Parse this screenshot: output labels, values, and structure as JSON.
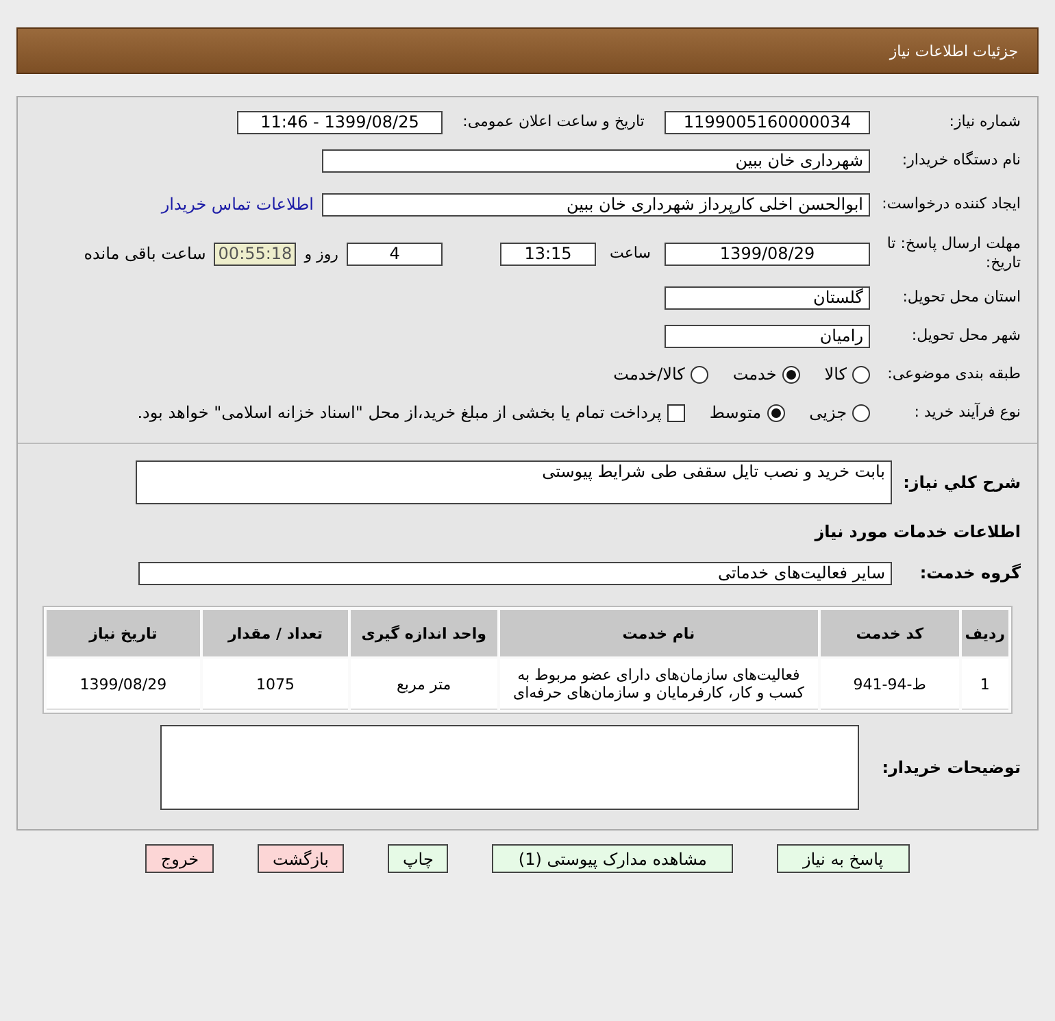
{
  "header": {
    "title": "جزئیات اطلاعات نیاز"
  },
  "need_number": {
    "label": "شماره نیاز:",
    "value": "1199005160000034"
  },
  "announce": {
    "label": "تاریخ و ساعت اعلان عمومی:",
    "value": "1399/08/25 - 11:46"
  },
  "buyer_org": {
    "label": "نام دستگاه خریدار:",
    "value": "شهرداری خان ببین"
  },
  "requester": {
    "label": "ایجاد کننده درخواست:",
    "value": "ابوالحسن اخلی کارپرداز شهرداری خان ببین",
    "link": "اطلاعات تماس خریدار"
  },
  "deadline": {
    "label": "مهلت ارسال پاسخ: تا تاریخ:",
    "date": "1399/08/29",
    "time_label": "ساعت",
    "time": "13:15",
    "days": "4",
    "days_label": "روز و",
    "remaining": "00:55:18",
    "remaining_label": "ساعت باقی مانده"
  },
  "province": {
    "label": "استان محل تحویل:",
    "value": "گلستان"
  },
  "city": {
    "label": "شهر محل تحویل:",
    "value": "رامیان"
  },
  "category": {
    "label": "طبقه بندی موضوعی:",
    "options": [
      {
        "label": "کالا",
        "selected": false
      },
      {
        "label": "خدمت",
        "selected": true
      },
      {
        "label": "کالا/خدمت",
        "selected": false
      }
    ]
  },
  "process": {
    "label": "نوع فرآیند خرید :",
    "options": [
      {
        "label": "جزیی",
        "selected": false
      },
      {
        "label": "متوسط",
        "selected": true
      }
    ],
    "payment": {
      "label": "پرداخت تمام یا بخشی از مبلغ خرید،از محل \"اسناد خزانه اسلامی\" خواهد بود.",
      "checked": false
    }
  },
  "description": {
    "label": "شرح كلي نياز:",
    "value": "بابت خرید و نصب تایل سقفی طی شرایط پیوستی"
  },
  "services_heading": "اطلاعات خدمات مورد نیاز",
  "service_group": {
    "label": "گروه خدمت:",
    "value": "سایر فعالیت‌های خدماتی"
  },
  "table": {
    "columns": [
      "ردیف",
      "کد خدمت",
      "نام خدمت",
      "واحد اندازه گیری",
      "تعداد / مقدار",
      "تاریخ نیاز"
    ],
    "rows": [
      [
        "1",
        "ط-94-941",
        "فعالیت‌های سازمان‌های دارای عضو مربوط به کسب و کار، کارفرمایان و سازمان‌های حرفه‌ای",
        "متر مربع",
        "1075",
        "1399/08/29"
      ]
    ]
  },
  "buyer_notes": {
    "label": "توضیحات خریدار:"
  },
  "buttons": [
    {
      "label": "پاسخ به نیاز",
      "kind": "primary"
    },
    {
      "label": "مشاهده مدارک پیوستی (1)",
      "kind": "primary"
    },
    {
      "label": "چاپ",
      "kind": "primary"
    },
    {
      "label": "بازگشت",
      "kind": "danger"
    },
    {
      "label": "خروج",
      "kind": "danger"
    }
  ]
}
